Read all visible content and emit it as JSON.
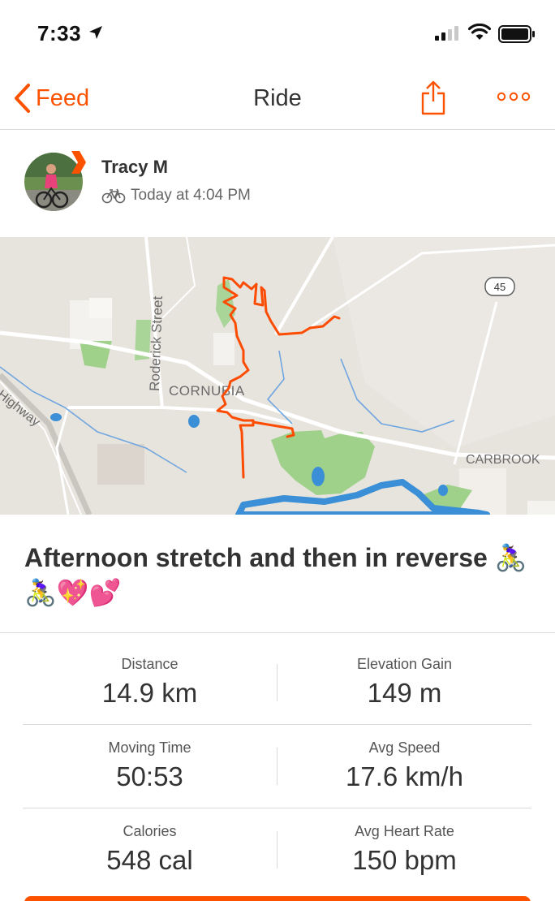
{
  "status_bar": {
    "time": "7:33"
  },
  "nav": {
    "back_label": "Feed",
    "title": "Ride"
  },
  "athlete": {
    "name": "Tracy M",
    "meta": "Today at 4:04 PM"
  },
  "map": {
    "labels": {
      "street": "Roderick Street",
      "suburb": "CORNUBIA",
      "highway": "Highway",
      "east": "CARBROOK",
      "route_shield": "45"
    }
  },
  "activity": {
    "title": "Afternoon stretch and then in reverse 🚴‍♀️🚴‍♀️💖💕"
  },
  "stats": [
    {
      "left_label": "Distance",
      "left_value": "14.9 km",
      "right_label": "Elevation Gain",
      "right_value": "149 m"
    },
    {
      "left_label": "Moving Time",
      "left_value": "50:53",
      "right_label": "Avg Speed",
      "right_value": "17.6 km/h"
    },
    {
      "left_label": "Calories",
      "left_value": "548 cal",
      "right_label": "Avg Heart Rate",
      "right_value": "150 bpm"
    }
  ],
  "colors": {
    "accent": "#fc5200",
    "route": "#fc4c02",
    "water": "#3a8fd6",
    "park": "#9fd18b"
  }
}
